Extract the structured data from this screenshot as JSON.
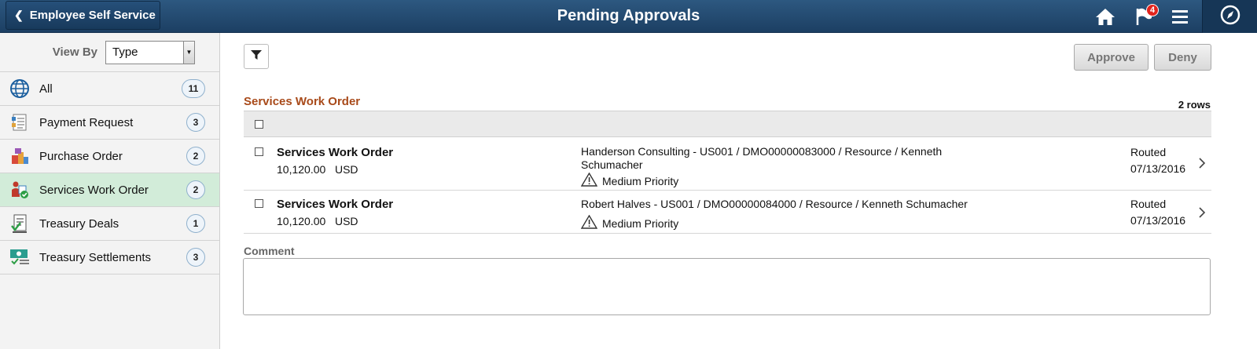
{
  "header": {
    "back_label": "Employee Self Service",
    "title": "Pending Approvals",
    "notification_count": "4",
    "icons": [
      "home-icon",
      "flag-icon",
      "menu-icon",
      "navbar-icon"
    ]
  },
  "sidebar": {
    "view_by_label": "View By",
    "view_by_value": "Type",
    "items": [
      {
        "label": "All",
        "count": "11",
        "icon": "globe-icon"
      },
      {
        "label": "Payment Request",
        "count": "3",
        "icon": "payment-request-icon"
      },
      {
        "label": "Purchase Order",
        "count": "2",
        "icon": "purchase-order-icon"
      },
      {
        "label": "Services Work Order",
        "count": "2",
        "icon": "services-work-order-icon",
        "active": true
      },
      {
        "label": "Treasury Deals",
        "count": "1",
        "icon": "treasury-deals-icon"
      },
      {
        "label": "Treasury Settlements",
        "count": "3",
        "icon": "treasury-settlements-icon"
      }
    ]
  },
  "toolbar": {
    "approve_label": "Approve",
    "deny_label": "Deny"
  },
  "grid": {
    "title": "Services Work Order",
    "row_count": "2 rows",
    "rows": [
      {
        "title": "Services Work Order",
        "amount": "10,120.00",
        "currency": "USD",
        "description": "Handerson Consulting - US001 / DMO00000083000 / Resource / Kenneth Schumacher",
        "priority": "Medium Priority",
        "status": "Routed",
        "date": "07/13/2016"
      },
      {
        "title": "Services Work Order",
        "amount": "10,120.00",
        "currency": "USD",
        "description": "Robert Halves - US001 / DMO00000084000 / Resource / Kenneth Schumacher",
        "priority": "Medium Priority",
        "status": "Routed",
        "date": "07/13/2016"
      }
    ]
  },
  "comment": {
    "label": "Comment",
    "value": ""
  },
  "colors": {
    "header": "#1f4468",
    "section_title": "#a84a1a",
    "active_item": "#d2ecd9",
    "badge": "#e2241d"
  }
}
